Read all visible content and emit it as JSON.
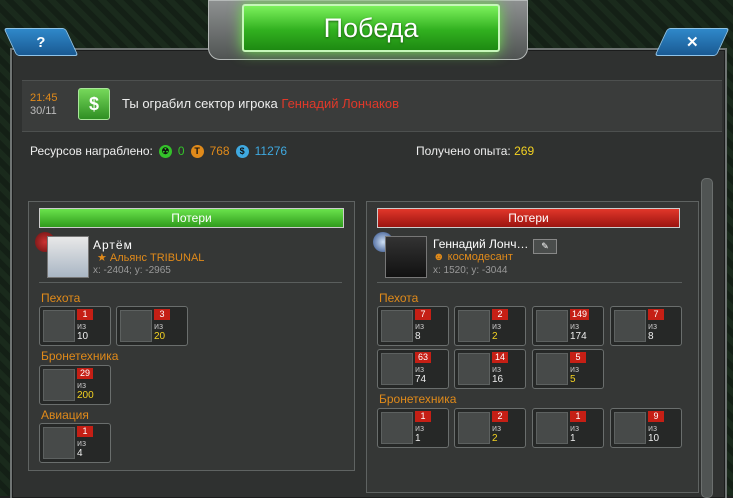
{
  "window": {
    "title": "Победа",
    "help_label": "?",
    "close_label": "✕"
  },
  "notification": {
    "time": "21:45",
    "date": "30/11",
    "message": "Ты ограбил сектор игрока",
    "target_player": "Геннадий Лончаков",
    "icon": "money-dollar-icon"
  },
  "resources": {
    "label": "Ресурсов награблено:",
    "items": [
      {
        "icon": "radiation-icon",
        "value": "0",
        "color": "#34c22a"
      },
      {
        "icon": "titanium-icon",
        "value": "768",
        "color": "#e08a1a"
      },
      {
        "icon": "dollar-icon",
        "value": "11276",
        "color": "#3fa9e0"
      }
    ]
  },
  "experience": {
    "label": "Получено опыта:",
    "value": "269"
  },
  "left_panel": {
    "banner": "Потери",
    "player_name": "Артём",
    "alliance": "Альянс TRIBUNAL",
    "coords": "x: -2404; y: -2965",
    "categories": [
      {
        "title": "Пехота",
        "units": [
          {
            "lost": "1",
            "of": "из",
            "total": "10"
          },
          {
            "lost": "3",
            "of": "из",
            "total": "20"
          }
        ]
      },
      {
        "title": "Бронетехника",
        "units": [
          {
            "lost": "29",
            "of": "из",
            "total": "200"
          }
        ]
      },
      {
        "title": "Авиация",
        "units": [
          {
            "lost": "1",
            "of": "из",
            "total": "4"
          }
        ]
      }
    ]
  },
  "right_panel": {
    "banner": "Потери",
    "player_name": "Геннадий Лонч…",
    "alliance": "космодесант",
    "coords": "x: 1520; y: -3044",
    "edit_icon": "pencil-icon",
    "categories": [
      {
        "title": "Пехота",
        "units": [
          {
            "lost": "7",
            "of": "из",
            "total": "8"
          },
          {
            "lost": "2",
            "of": "из",
            "total": "2"
          },
          {
            "lost": "149",
            "of": "из",
            "total": "174"
          },
          {
            "lost": "7",
            "of": "из",
            "total": "8"
          },
          {
            "lost": "63",
            "of": "из",
            "total": "74"
          },
          {
            "lost": "14",
            "of": "из",
            "total": "16"
          },
          {
            "lost": "5",
            "of": "из",
            "total": "5"
          }
        ]
      },
      {
        "title": "Бронетехника",
        "units": [
          {
            "lost": "1",
            "of": "из",
            "total": "1"
          },
          {
            "lost": "2",
            "of": "из",
            "total": "2"
          },
          {
            "lost": "1",
            "of": "из",
            "total": "1"
          },
          {
            "lost": "9",
            "of": "из",
            "total": "10"
          }
        ]
      }
    ]
  }
}
